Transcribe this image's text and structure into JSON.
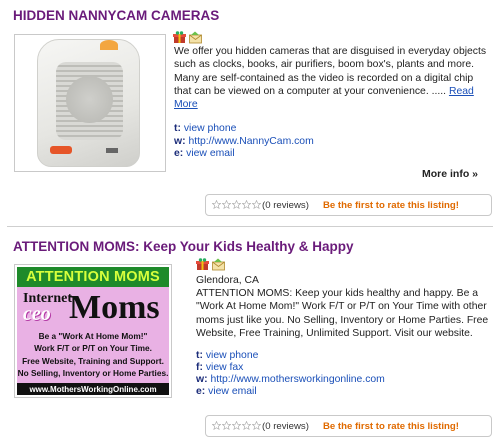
{
  "listings": [
    {
      "title": "HIDDEN NANNYCAM CAMERAS",
      "description": "We offer you hidden cameras that are disguised in everyday objects such as clocks, books, air purifiers, boom box's, plants and more. Many are self-contained as the video is recorded on a digital chip that can be viewed on a computer at your convenience. .....",
      "read_more": "Read More",
      "contacts": [
        {
          "key": "t:",
          "value": "view phone"
        },
        {
          "key": "w:",
          "value": "http://www.NannyCam.com"
        },
        {
          "key": "e:",
          "value": "view email"
        }
      ],
      "more_info": "More info »",
      "reviews": "(0 reviews)",
      "rate_prompt": "Be the first to rate this listing!"
    },
    {
      "title": "ATTENTION MOMS: Keep Your Kids Healthy & Happy",
      "location": "Glendora, CA",
      "description": "ATTENTION MOMS: Keep your kids healthy and happy. Be a \"Work At Home Mom!\" Work F/T or P/T on Your Time with other moms just like you. No Selling, Inventory or Home Parties. Free Website, Free Training, Unlimited Support. Visit our website.",
      "contacts": [
        {
          "key": "t:",
          "value": "view phone"
        },
        {
          "key": "f:",
          "value": "view fax"
        },
        {
          "key": "w:",
          "value": "http://www.mothersworkingonline.com"
        },
        {
          "key": "e:",
          "value": "view email"
        }
      ],
      "reviews": "(0 reviews)",
      "rate_prompt": "Be the first to rate this listing!",
      "ad": {
        "headline": "ATTENTION MOMS",
        "internet": "Internet",
        "ceo": "ceo",
        "moms": "Moms",
        "line1": "Be a \"Work At Home Mom!\"",
        "line2": "Work F/T or P/T on Your Time.",
        "line3": "Free Website, Training and Support.",
        "line4": "No Selling, Inventory or Home Parties.",
        "url": "www.MothersWorkingOnline.com"
      }
    }
  ],
  "colors": {
    "title": "#6a1b7a",
    "link": "#1a4fb8",
    "contact_key": "#1c2d7a",
    "rate": "#e06a00"
  },
  "icons": [
    "gift-icon",
    "envelope-icon",
    "star-icon"
  ]
}
